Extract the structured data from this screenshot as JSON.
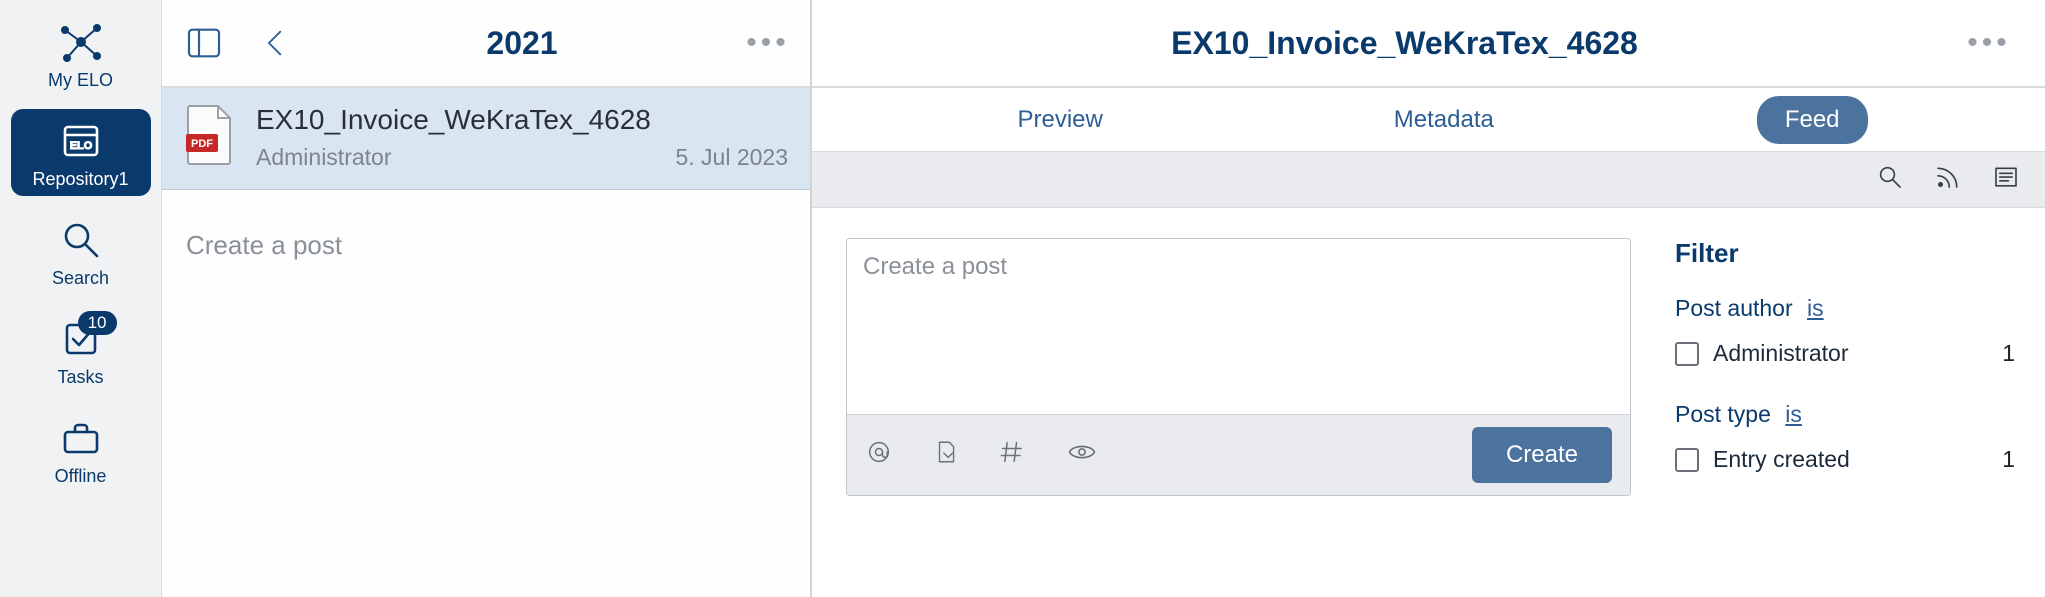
{
  "sidebar": {
    "items": [
      {
        "id": "myelo",
        "label": "My ELO"
      },
      {
        "id": "repository",
        "label": "Repository1"
      },
      {
        "id": "search",
        "label": "Search"
      },
      {
        "id": "tasks",
        "label": "Tasks",
        "badge": "10"
      },
      {
        "id": "offline",
        "label": "Offline"
      }
    ]
  },
  "list": {
    "header_title": "2021",
    "items": [
      {
        "name": "EX10_Invoice_WeKraTex_4628",
        "author": "Administrator",
        "date": "5. Jul 2023",
        "file_type": "PDF"
      }
    ],
    "create_post_prompt": "Create a post"
  },
  "detail": {
    "title": "EX10_Invoice_WeKraTex_4628",
    "tabs": [
      {
        "id": "preview",
        "label": "Preview"
      },
      {
        "id": "metadata",
        "label": "Metadata"
      },
      {
        "id": "feed",
        "label": "Feed"
      }
    ],
    "active_tab": "feed",
    "post_placeholder": "Create a post",
    "create_button": "Create",
    "filter": {
      "heading": "Filter",
      "groups": [
        {
          "label": "Post author",
          "operator": "is",
          "items": [
            {
              "label": "Administrator",
              "count": "1"
            }
          ]
        },
        {
          "label": "Post type",
          "operator": "is",
          "items": [
            {
              "label": "Entry created",
              "count": "1"
            }
          ]
        }
      ]
    }
  }
}
